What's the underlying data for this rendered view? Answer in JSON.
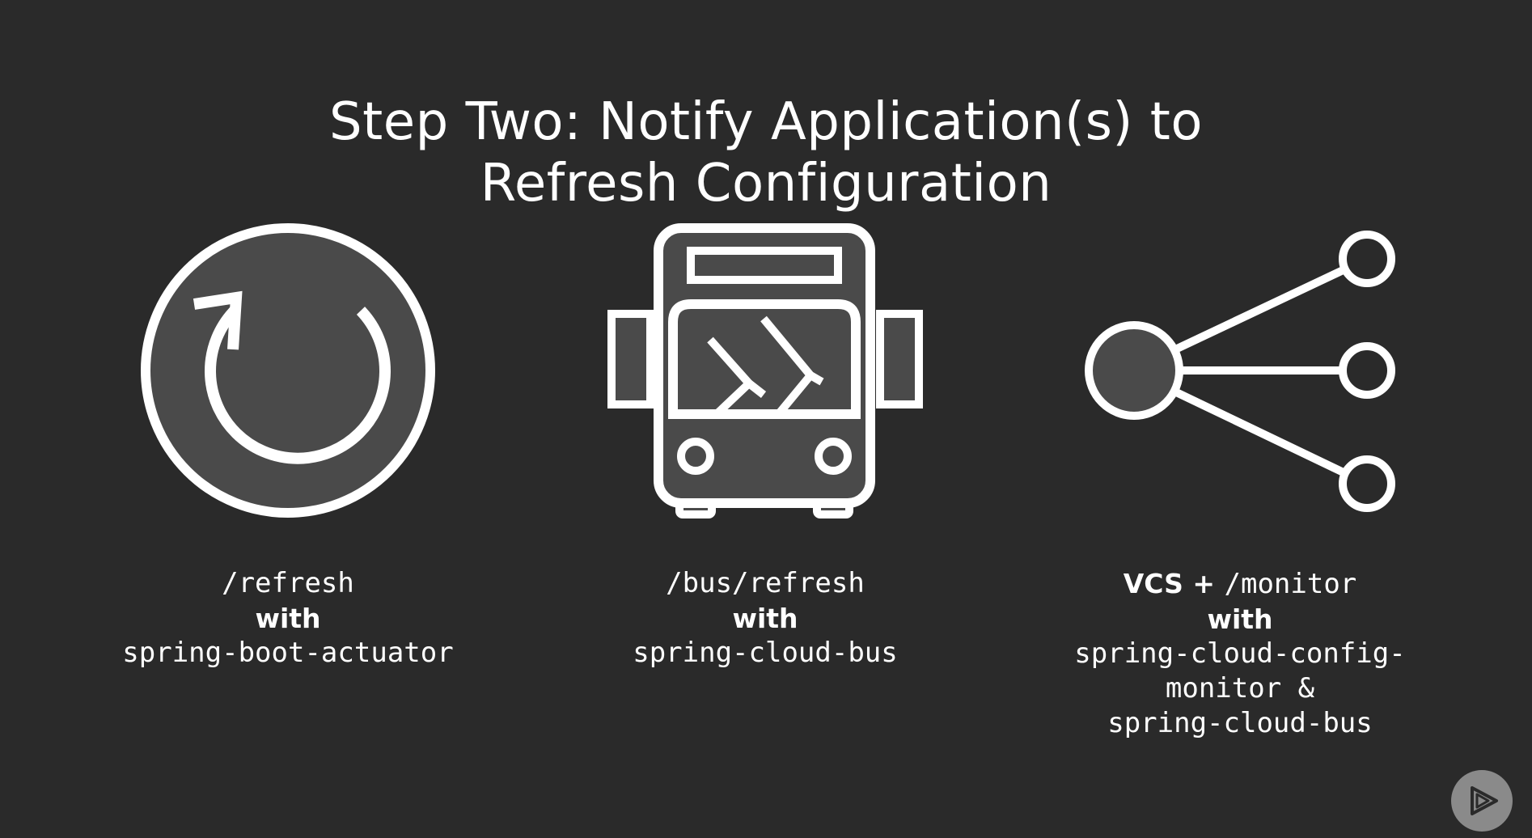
{
  "slide": {
    "title_line1": "Step Two: Notify Application(s) to",
    "title_line2": "Refresh Configuration"
  },
  "options": [
    {
      "icon": "refresh-icon",
      "endpoint": "/refresh",
      "connector": "with",
      "library": "spring-boot-actuator"
    },
    {
      "icon": "bus-icon",
      "endpoint": "/bus/refresh",
      "connector": "with",
      "library": "spring-cloud-bus"
    },
    {
      "icon": "broadcast-network-icon",
      "prefix": "VCS + ",
      "endpoint": "/monitor",
      "connector": "with",
      "library_lines": [
        "spring-cloud-config-",
        "monitor &",
        "spring-cloud-bus"
      ]
    }
  ],
  "colors": {
    "background": "#2a2a2a",
    "icon_fill": "#4a4a4a",
    "foreground": "#ffffff",
    "logo": "#8a8a8a"
  },
  "logo": {
    "icon": "play-logo-icon"
  }
}
